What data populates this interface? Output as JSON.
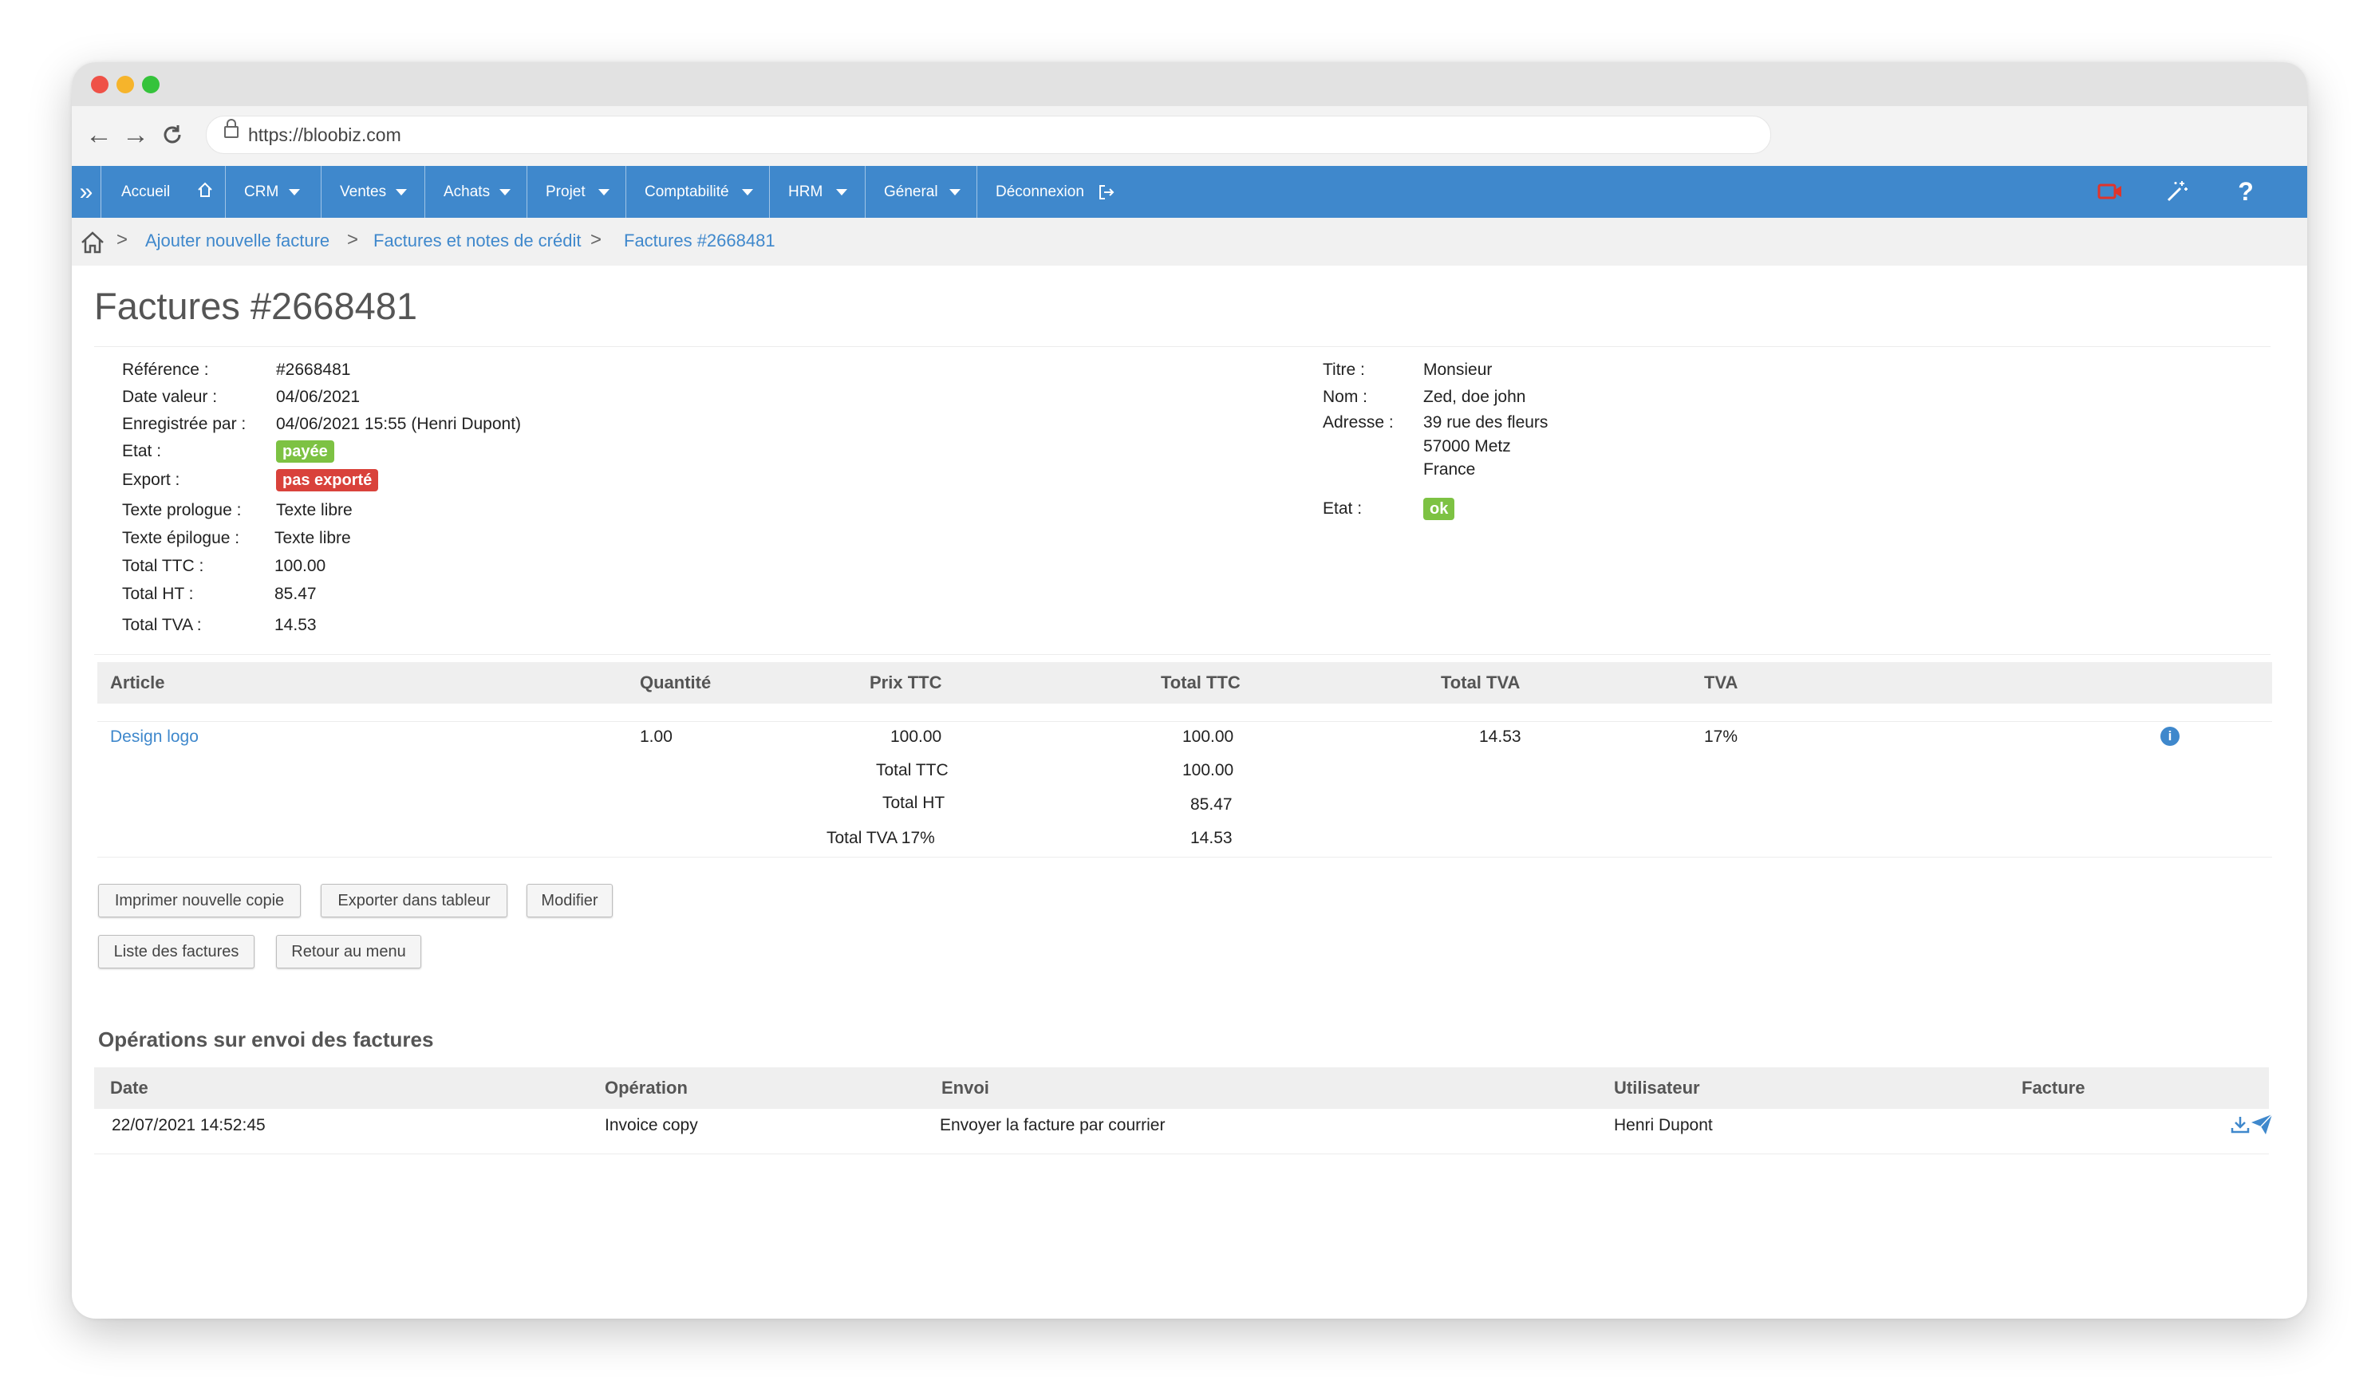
{
  "browser": {
    "url": "https://bloobiz.com"
  },
  "nav": {
    "toggle": "»",
    "items": [
      {
        "label": "Accueil"
      },
      {
        "label": "CRM"
      },
      {
        "label": "Ventes"
      },
      {
        "label": "Achats"
      },
      {
        "label": "Projet"
      },
      {
        "label": "Comptabilité"
      },
      {
        "label": "HRM"
      },
      {
        "label": "Géneral"
      },
      {
        "label": "Déconnexion"
      }
    ],
    "help": "?"
  },
  "breadcrumb": [
    "Ajouter nouvelle facture",
    "Factures et notes de crédit",
    "Factures #2668481"
  ],
  "page_title": "Factures #2668481",
  "details_left": [
    {
      "label": "Référence :",
      "value": "#2668481"
    },
    {
      "label": "Date valeur :",
      "value": "04/06/2021"
    },
    {
      "label": "Enregistrée par :",
      "value": "04/06/2021 15:55 (Henri Dupont)"
    },
    {
      "label": "Etat :",
      "value": "payée"
    },
    {
      "label": "Export :",
      "value": "pas exporté"
    },
    {
      "label": "Texte prologue :",
      "value": "Texte libre"
    },
    {
      "label": "Texte épilogue :",
      "value": "Texte libre"
    },
    {
      "label": "Total TTC :",
      "value": "100.00"
    },
    {
      "label": "Total HT :",
      "value": "85.47"
    },
    {
      "label": "Total TVA :",
      "value": "14.53"
    }
  ],
  "details_right": {
    "titre_label": "Titre :",
    "titre": "Monsieur",
    "nom_label": "Nom :",
    "nom": "Zed, doe john",
    "adresse_label": "Adresse :",
    "adresse": [
      "39 rue des fleurs",
      "57000 Metz",
      "France"
    ],
    "etat_label": "Etat :",
    "etat": "ok"
  },
  "articles": {
    "headers": [
      "Article",
      "Quantité",
      "Prix TTC",
      "Total TTC",
      "Total TVA",
      "TVA"
    ],
    "row": {
      "article": "Design logo",
      "quantite": "1.00",
      "prix_ttc": "100.00",
      "total_ttc": "100.00",
      "total_tva": "14.53",
      "tva": "17%"
    },
    "totals": [
      {
        "label": "Total TTC",
        "value": "100.00"
      },
      {
        "label": "Total HT",
        "value": "85.47"
      },
      {
        "label": "Total TVA 17%",
        "value": "14.53"
      }
    ]
  },
  "buttons": {
    "print": "Imprimer nouvelle copie",
    "export": "Exporter dans tableur",
    "modify": "Modifier",
    "list": "Liste des factures",
    "back": "Retour au menu"
  },
  "operations": {
    "title": "Opérations sur envoi des factures",
    "headers": [
      "Date",
      "Opération",
      "Envoi",
      "Utilisateur",
      "Facture"
    ],
    "row": {
      "date": "22/07/2021 14:52:45",
      "operation": "Invoice copy",
      "envoi": "Envoyer la facture par courrier",
      "utilisateur": "Henri Dupont"
    }
  },
  "colors": {
    "accent": "#3f88cc",
    "success": "#7dc243",
    "danger": "#d9423b"
  }
}
